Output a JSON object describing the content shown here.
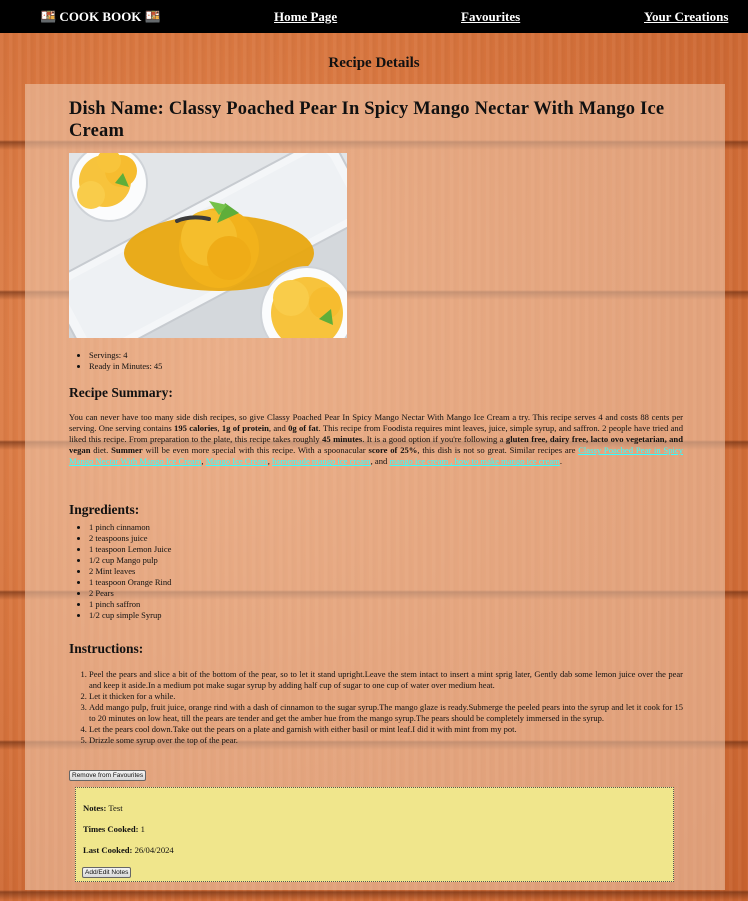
{
  "nav": {
    "brand": "🍱 COOK BOOK 🍱",
    "home": "Home Page",
    "favourites": "Favourites",
    "creations": "Your Creations"
  },
  "page_heading": "Recipe Details",
  "recipe": {
    "title": "Dish Name: Classy Poached Pear In Spicy Mango Nectar With Mango Ice Cream",
    "servings": "Servings: 4",
    "ready": "Ready in Minutes: 45"
  },
  "summary": {
    "heading": "Recipe Summary:",
    "p1": "You can never have too many side dish recipes, so give Classy Poached Pear In Spicy Mango Nectar With Mango Ice Cream a try. This recipe serves 4 and costs 88 cents per serving. One serving contains ",
    "b1": "195 calories",
    "p2": ", ",
    "b2": "1g of protein",
    "p3": ", and ",
    "b3": "0g of fat",
    "p4": ". This recipe from Foodista requires mint leaves, juice, simple syrup, and saffron. 2 people have tried and liked this recipe. From preparation to the plate, this recipe takes roughly ",
    "b4": "45 minutes",
    "p5": ". It is a good option if you're following a ",
    "b5": "gluten free, dairy free, lacto ovo vegetarian, and vegan",
    "p6": " diet. ",
    "b6": "Summer",
    "p7": " will be even more special with this recipe. With a spoonacular ",
    "b7": "score of 25%",
    "p8": ", this dish is not so great. Similar recipes are ",
    "link1": "Classy Poached Pear in Spicy Mango Nectar With Mango Ice Cream",
    "p9": ", ",
    "link2": "Mango Ice Cream",
    "p10": ", ",
    "link3": "homemade mango ice cream",
    "p11": ", and ",
    "link4": "mango ice cream , how to make mango ice cream",
    "p12": "."
  },
  "ingredients": {
    "heading": "Ingredients:",
    "items": [
      "1 pinch cinnamon",
      "2 teaspoons juice",
      "1 teaspoon Lemon Juice",
      "1/2 cup Mango pulp",
      "2 Mint leaves",
      "1 teaspoon Orange Rind",
      "2 Pears",
      "1 pinch saffron",
      "1/2 cup simple Syrup"
    ]
  },
  "instructions": {
    "heading": "Instructions:",
    "steps": [
      "Peel the pears and slice a bit of the bottom of the pear, so to let it stand upright.Leave the stem intact to insert a mint sprig later, Gently dab some lemon juice over the pear and keep it aside.In a medium pot make sugar syrup by adding half cup of sugar to one cup of water over medium heat.",
      "Let it thicken for a while.",
      "Add mango pulp, fruit juice, orange rind with a dash of cinnamon to the sugar syrup.The mango glaze is ready.Submerge the peeled pears into the syrup and let it cook for 15 to 20 minutes on low heat, till the pears are tender and get the amber hue from the mango syrup.The pears should be completely immersed in the syrup.",
      "Let the pears cool down.Take out the pears on a plate and garnish with either basil or mint leaf.I did it with mint from my pot.",
      "Drizzle some syrup over the top of the pear."
    ]
  },
  "remove_button": "Remove from Favourites",
  "notes": {
    "notes_label": "Notes:",
    "notes_value": "Test",
    "times_label": "Times Cooked:",
    "times_value": "1",
    "last_label": "Last Cooked:",
    "last_value": "26/04/2024",
    "button": "Add/Edit Notes"
  },
  "colors": {
    "navbar": "#000000",
    "notes_bg": "#f0e68c",
    "link": "#33ffff"
  }
}
